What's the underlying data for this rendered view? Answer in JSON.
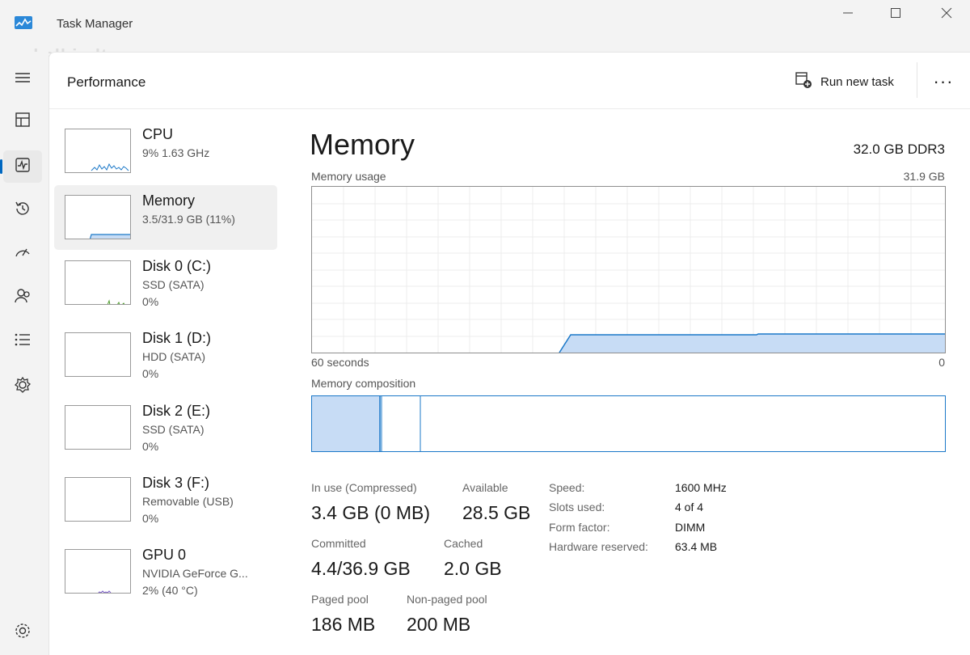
{
  "window": {
    "title": "Task Manager",
    "watermark": "skelbiu.lt"
  },
  "header": {
    "page_title": "Performance",
    "run_new_task": "Run new task",
    "more": "···"
  },
  "nav": {
    "items": [
      "menu-icon",
      "processes-icon",
      "performance-icon",
      "app-history-icon",
      "startup-apps-icon",
      "users-icon",
      "details-icon",
      "services-icon",
      "settings-icon"
    ],
    "active": "performance-icon",
    "accent": "#0067c0"
  },
  "devices": [
    {
      "name": "CPU",
      "line1": "9% 1.63 GHz",
      "line2": ""
    },
    {
      "name": "Memory",
      "line1": "3.5/31.9 GB (11%)",
      "line2": ""
    },
    {
      "name": "Disk 0 (C:)",
      "line1": "SSD (SATA)",
      "line2": "0%"
    },
    {
      "name": "Disk 1 (D:)",
      "line1": "HDD (SATA)",
      "line2": "0%"
    },
    {
      "name": "Disk 2 (E:)",
      "line1": "SSD (SATA)",
      "line2": "0%"
    },
    {
      "name": "Disk 3 (F:)",
      "line1": "Removable (USB)",
      "line2": "0%"
    },
    {
      "name": "GPU 0",
      "line1": "NVIDIA GeForce G...",
      "line2": "2% (40 °C)"
    }
  ],
  "detail": {
    "title": "Memory",
    "spec": "32.0 GB DDR3",
    "usage_label": "Memory usage",
    "usage_max": "31.9 GB",
    "time_left": "60 seconds",
    "time_right": "0",
    "composition_label": "Memory composition",
    "stats": {
      "in_use_label": "In use (Compressed)",
      "in_use_value": "3.4 GB (0 MB)",
      "available_label": "Available",
      "available_value": "28.5 GB",
      "committed_label": "Committed",
      "committed_value": "4.4/36.9 GB",
      "cached_label": "Cached",
      "cached_value": "2.0 GB",
      "paged_label": "Paged pool",
      "paged_value": "186 MB",
      "nonpaged_label": "Non-paged pool",
      "nonpaged_value": "200 MB"
    },
    "specs": {
      "speed_label": "Speed:",
      "speed_value": "1600 MHz",
      "slots_label": "Slots used:",
      "slots_value": "4 of 4",
      "form_label": "Form factor:",
      "form_value": "DIMM",
      "reserved_label": "Hardware reserved:",
      "reserved_value": "63.4 MB"
    }
  },
  "colors": {
    "memory_fill": "#c7dcf5",
    "memory_line": "#1b78c8",
    "cpu_line": "#1b78c8",
    "disk_line": "#4c9a2a",
    "gpu_line": "#7a5cc8"
  }
}
